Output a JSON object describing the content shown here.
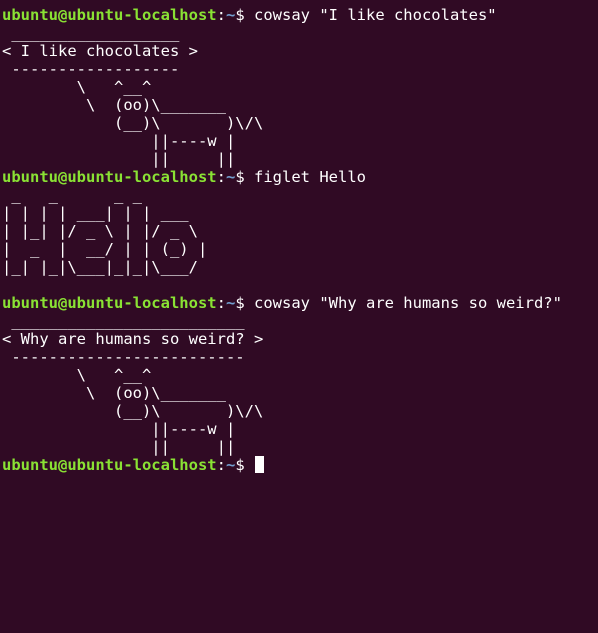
{
  "theme": {
    "background": "#300a24",
    "foreground": "#ffffff",
    "user_host_color": "#8ae234",
    "path_color": "#729fcf",
    "cursor_color": "#ffffff"
  },
  "prompt": {
    "user_host": "ubuntu@ubuntu-localhost",
    "separator": ":",
    "path": "~",
    "symbol": "$ "
  },
  "blocks": [
    {
      "command": "cowsay \"I like chocolates\"",
      "output": [
        " __________________",
        "< I like chocolates >",
        " ------------------",
        "        \\   ^__^",
        "         \\  (oo)\\_______",
        "            (__)\\       )\\/\\",
        "                ||----w |",
        "                ||     ||"
      ]
    },
    {
      "command": "figlet Hello",
      "output": [
        " _   _      _ _",
        "| | | | ___| | | ___",
        "| |_| |/ _ \\ | |/ _ \\",
        "|  _  |  __/ | | (_) |",
        "|_| |_|\\___|_|_|\\___/",
        ""
      ]
    },
    {
      "command": "cowsay \"Why are humans so weird?\"",
      "output": [
        " _________________________",
        "< Why are humans so weird? >",
        " -------------------------",
        "        \\   ^__^",
        "         \\  (oo)\\_______",
        "            (__)\\       )\\/\\",
        "                ||----w |",
        "                ||     ||"
      ]
    }
  ]
}
